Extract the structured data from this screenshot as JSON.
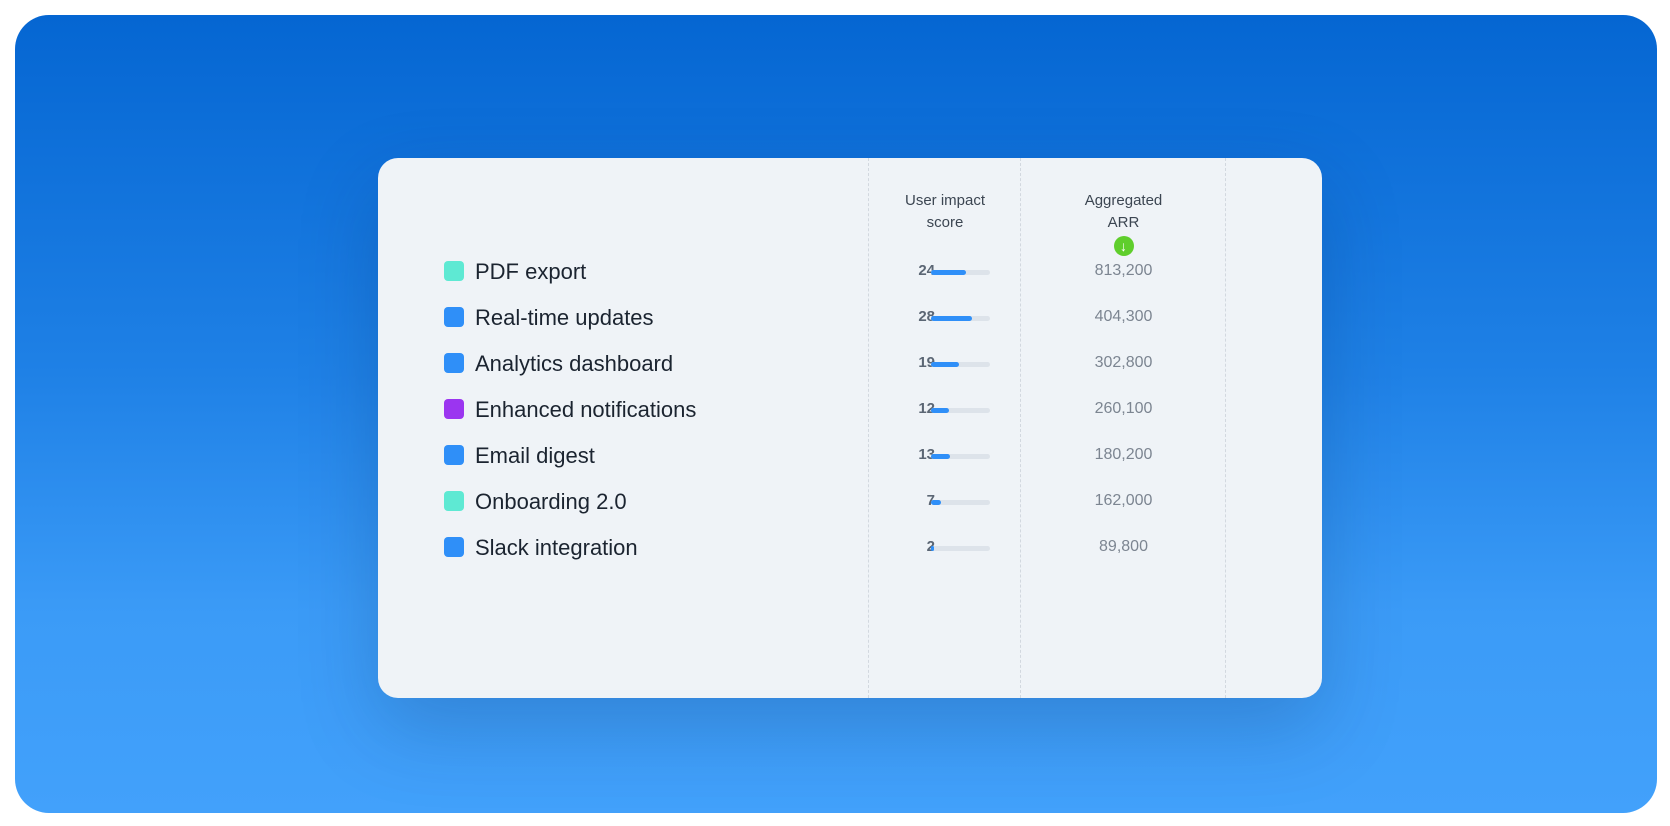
{
  "table": {
    "headers": {
      "impact_line1": "User impact",
      "impact_line2": "score",
      "arr_line1": "Aggregated",
      "arr_line2": "ARR",
      "sort_icon": "arrow-down-circle-icon"
    },
    "score_max": 40,
    "rows": [
      {
        "name": "PDF export",
        "color": "#5ee9d3",
        "score": "24",
        "score_value": 24,
        "arr": "813,200"
      },
      {
        "name": "Real-time updates",
        "color": "#2f8ff8",
        "score": "28",
        "score_value": 28,
        "arr": "404,300"
      },
      {
        "name": "Analytics dashboard",
        "color": "#2f8ff8",
        "score": "19",
        "score_value": 19,
        "arr": "302,800"
      },
      {
        "name": "Enhanced notifications",
        "color": "#9b35f0",
        "score": "12",
        "score_value": 12,
        "arr": "260,100"
      },
      {
        "name": "Email digest",
        "color": "#2f8ff8",
        "score": "13",
        "score_value": 13,
        "arr": "180,200"
      },
      {
        "name": "Onboarding 2.0",
        "color": "#5ee9d3",
        "score": "7",
        "score_value": 7,
        "arr": "162,000"
      },
      {
        "name": "Slack integration",
        "color": "#2f8ff8",
        "score": "2",
        "score_value": 2,
        "arr": "89,800"
      }
    ]
  },
  "colors": {
    "background_top": "#0566d2",
    "background_bottom": "#42a1fb",
    "card": "#eff3f7",
    "bar_fill": "#2f8ff8",
    "sort_icon": "#5fce2c"
  }
}
